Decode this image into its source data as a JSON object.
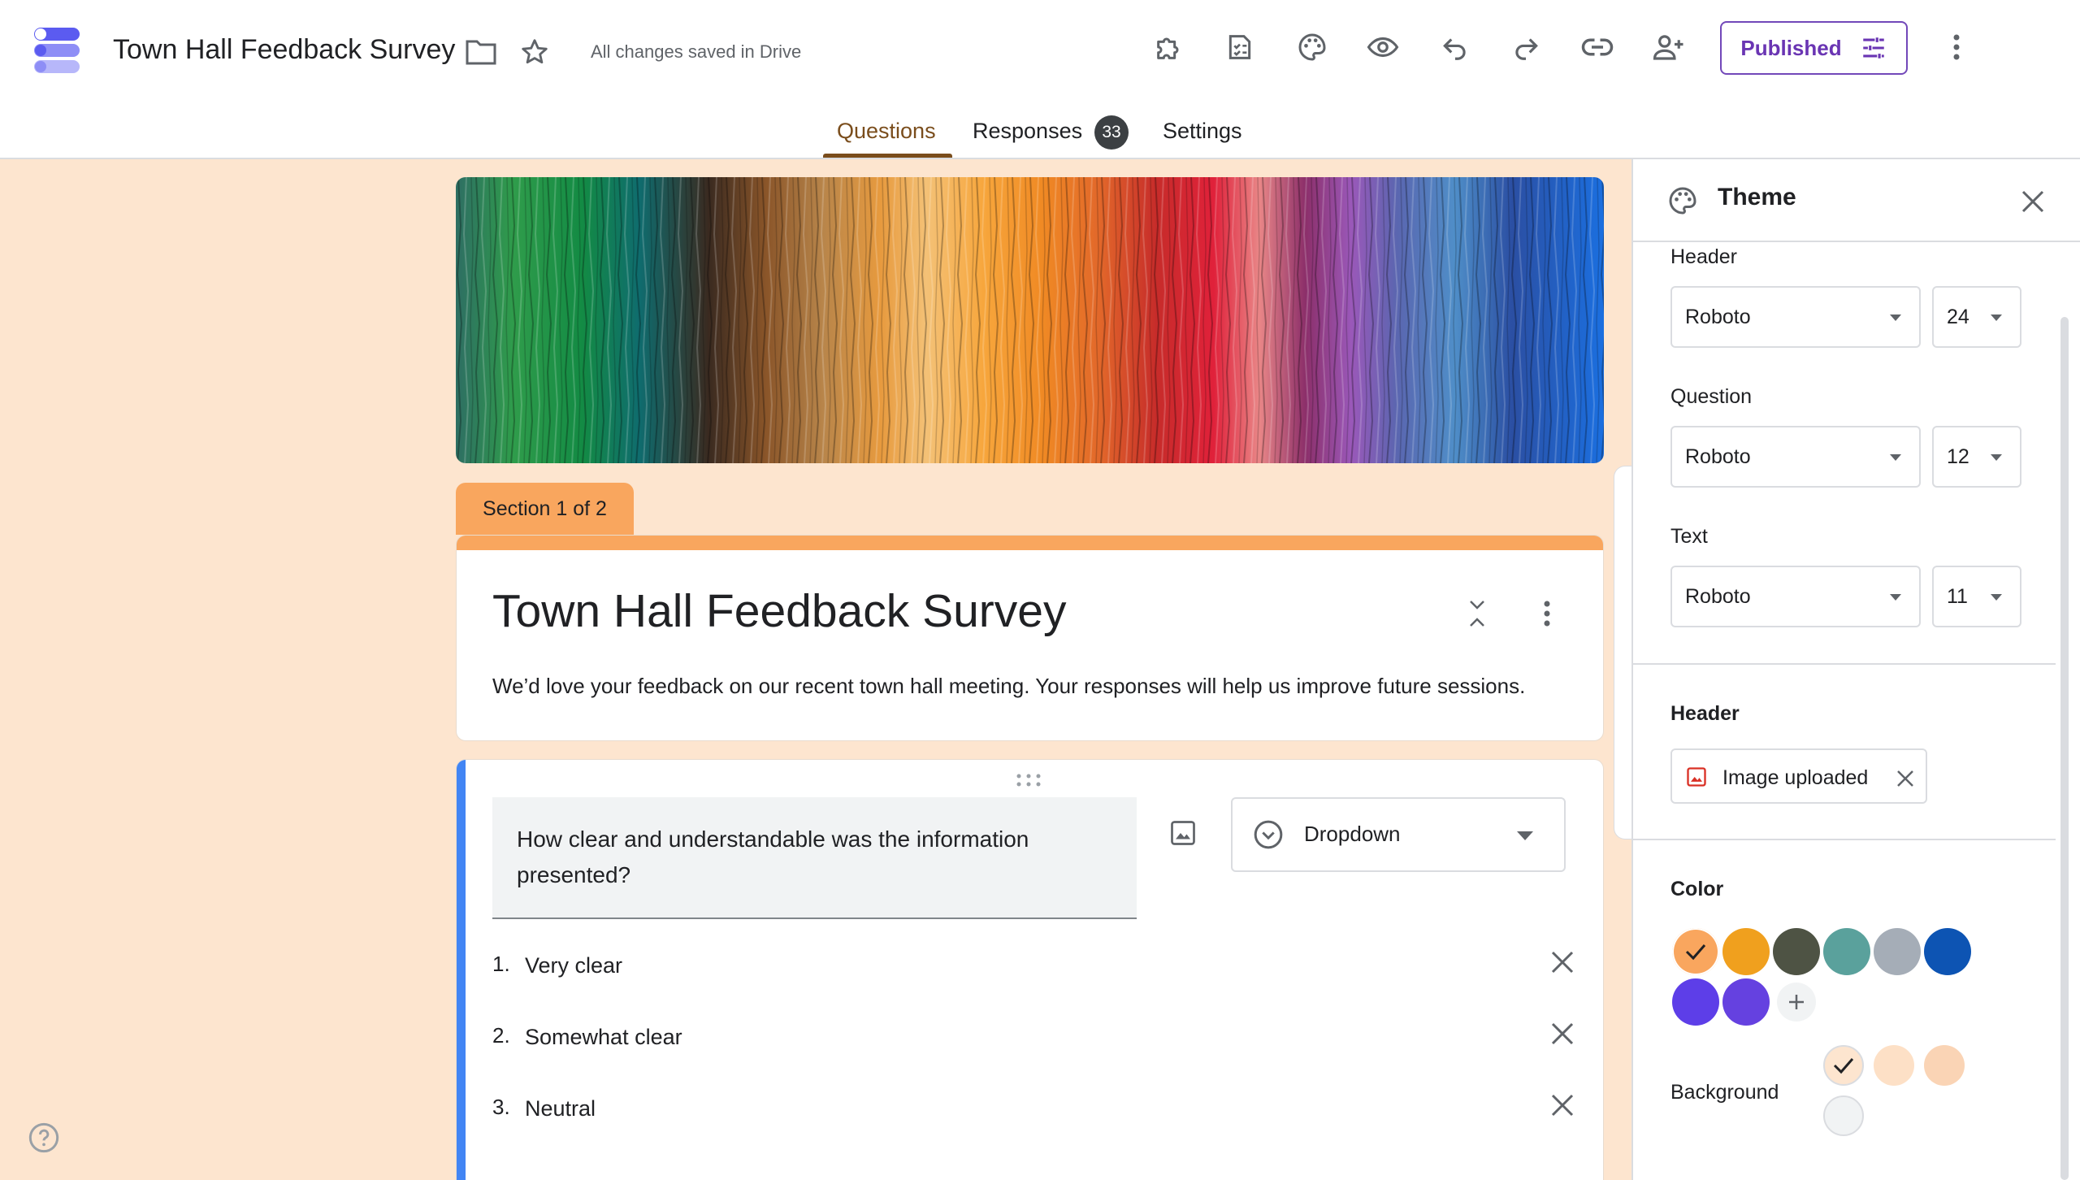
{
  "app": {
    "title": "Town Hall Feedback Survey",
    "save_status": "All changes saved in Drive",
    "publish_label": "Published",
    "brand_color": "#673ab7"
  },
  "icons": {
    "folder": "folder-icon",
    "star": "star-icon",
    "addons": "puzzle-icon",
    "quiz": "checklist-icon",
    "theme": "palette-icon",
    "preview": "eye-icon",
    "undo": "undo-icon",
    "redo": "redo-icon",
    "link": "link-icon",
    "share": "person-add-icon",
    "more": "more-vert-icon",
    "help": "help-icon"
  },
  "tabs": [
    {
      "label": "Questions",
      "active": true
    },
    {
      "label": "Responses",
      "badge": "33"
    },
    {
      "label": "Settings"
    }
  ],
  "section": {
    "label": "Section 1 of 2",
    "title": "Town Hall Feedback Survey",
    "description": "We’d love your feedback on our recent town hall meeting. Your responses will help us improve future sessions."
  },
  "question": {
    "text": "How clear and understandable was the information presented?",
    "type": "Dropdown",
    "options": [
      {
        "num": "1.",
        "label": "Very clear"
      },
      {
        "num": "2.",
        "label": "Somewhat clear"
      },
      {
        "num": "3.",
        "label": "Neutral"
      }
    ]
  },
  "theme_panel": {
    "title": "Theme",
    "text_style": {
      "header": {
        "label": "Header",
        "font": "Roboto",
        "size": "24"
      },
      "question": {
        "label": "Question",
        "font": "Roboto",
        "size": "12"
      },
      "text": {
        "label": "Text",
        "font": "Roboto",
        "size": "11"
      }
    },
    "header_image": {
      "label": "Header",
      "value": "Image uploaded"
    },
    "color": {
      "label": "Color",
      "selected": "#f9a65e",
      "swatches": [
        "#f9a65e",
        "#f0a01e",
        "#4e5344",
        "#5aa19c",
        "#a5adb7",
        "#0d54b3",
        "#5d3ee8",
        "#6541e0"
      ]
    },
    "background": {
      "label": "Background",
      "selected": "#fde5cf",
      "swatches": [
        "#fde5cf",
        "#fde0c6",
        "#fad4b5",
        "#f1f3f4"
      ]
    }
  }
}
